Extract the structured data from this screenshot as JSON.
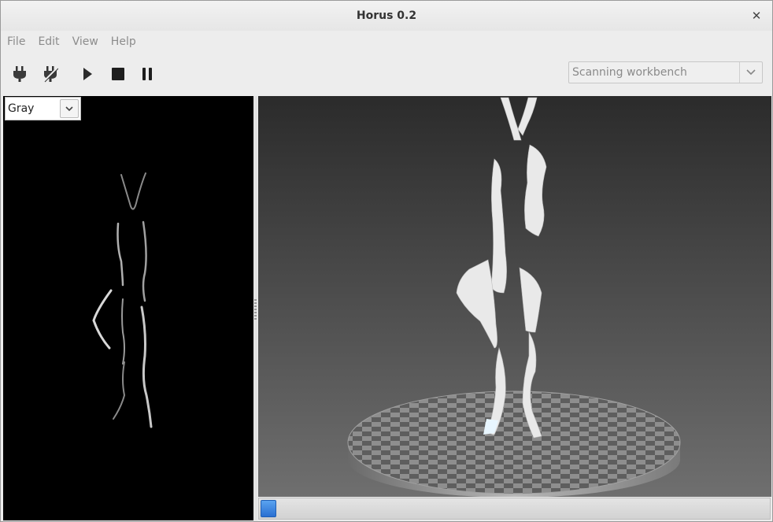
{
  "window": {
    "title": "Horus 0.2",
    "close_glyph": "✕"
  },
  "menu": [
    "File",
    "Edit",
    "View",
    "Help"
  ],
  "toolbar": {
    "icons": [
      "connect-icon",
      "disconnect-icon",
      "play-icon",
      "stop-icon",
      "pause-icon"
    ],
    "workbench": {
      "selected": "Scanning workbench"
    }
  },
  "camera_view": {
    "mode": "Gray"
  },
  "scan_progress": 0.03,
  "colors": {
    "accent": "#3b82e0",
    "scene_top": "#2b2b2b",
    "scene_bottom": "#6f6f6f",
    "platform": "#9a9a9a"
  }
}
